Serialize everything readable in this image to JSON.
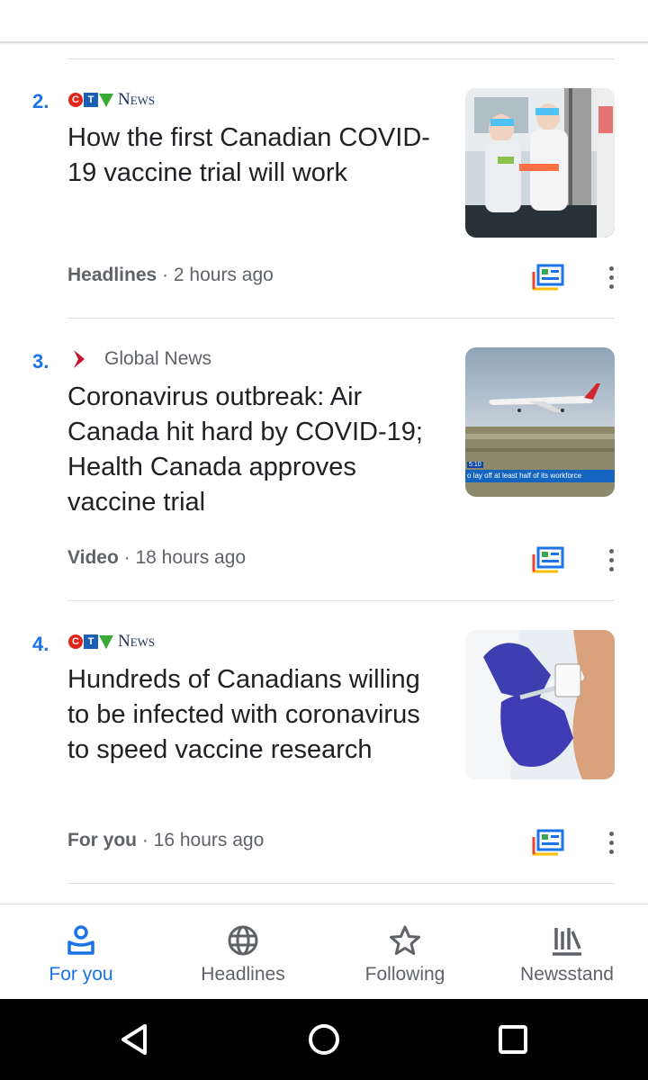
{
  "feed": {
    "stories": [
      {
        "rank": "2.",
        "source": "CTV News",
        "source_logo": "ctv-news-logo",
        "title": "How the first Canadian COVID-19 vaccine trial will work",
        "category": "Headlines",
        "time": "2 hours ago",
        "thumbnail": "lab-researchers-image"
      },
      {
        "rank": "3.",
        "source": "Global News",
        "source_logo": "global-news-logo",
        "title": "Coronavirus outbreak: Air Canada hit hard by COVID-19; Health Canada approves vaccine trial",
        "category": "Video",
        "time": "18 hours ago",
        "thumbnail": "air-canada-plane-image",
        "thumbnail_caption_time": "5:10",
        "thumbnail_caption": "o lay off at least half of its workforce"
      },
      {
        "rank": "4.",
        "source": "CTV News",
        "source_logo": "ctv-news-logo",
        "title": "Hundreds of Canadians willing to be infected with coronavirus to speed vaccine research",
        "category": "For you",
        "time": "16 hours ago",
        "thumbnail": "vaccine-injection-image"
      }
    ],
    "separator": " · "
  },
  "nav": {
    "items": [
      {
        "label": "For you",
        "icon": "for-you-icon",
        "active": true
      },
      {
        "label": "Headlines",
        "icon": "globe-icon",
        "active": false
      },
      {
        "label": "Following",
        "icon": "star-icon",
        "active": false
      },
      {
        "label": "Newsstand",
        "icon": "newsstand-icon",
        "active": false
      }
    ]
  },
  "colors": {
    "accent": "#1a73e8",
    "ctv_red": "#e2231a",
    "ctv_blue": "#1a5fb4",
    "ctv_green": "#3aa935",
    "global_red": "#c8102e",
    "air_canada_red": "#d22630"
  }
}
